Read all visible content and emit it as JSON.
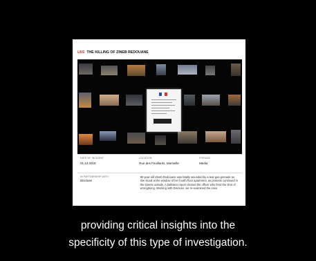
{
  "card": {
    "tag": "LBS",
    "title": "THE KILLING OF ZINEB REDOUANE",
    "details": {
      "date_label": "DATE OF INCIDENT",
      "date_value": "01.12.2018",
      "location_label": "LOCATION",
      "location_value": "Rue des Feuillants, Marseille",
      "forums_label": "FORUMS",
      "forums_value": "Media",
      "partnership_label": "IN PARTNERSHIP WITH",
      "partnership_value": "Disclose",
      "description": "80-year-old Zineb Redouane was fatally wounded by a tear gas grenade as she stood at the window of her fourth-floor apartment, as protests continued in the streets outside. A ballistics report cleared the officer who fired the shot of wrongdoing. Working with Disclose, we re-examined the case."
    }
  },
  "caption": {
    "line1": "providing critical insights into the",
    "line2": "specificity of this type of investigation."
  }
}
